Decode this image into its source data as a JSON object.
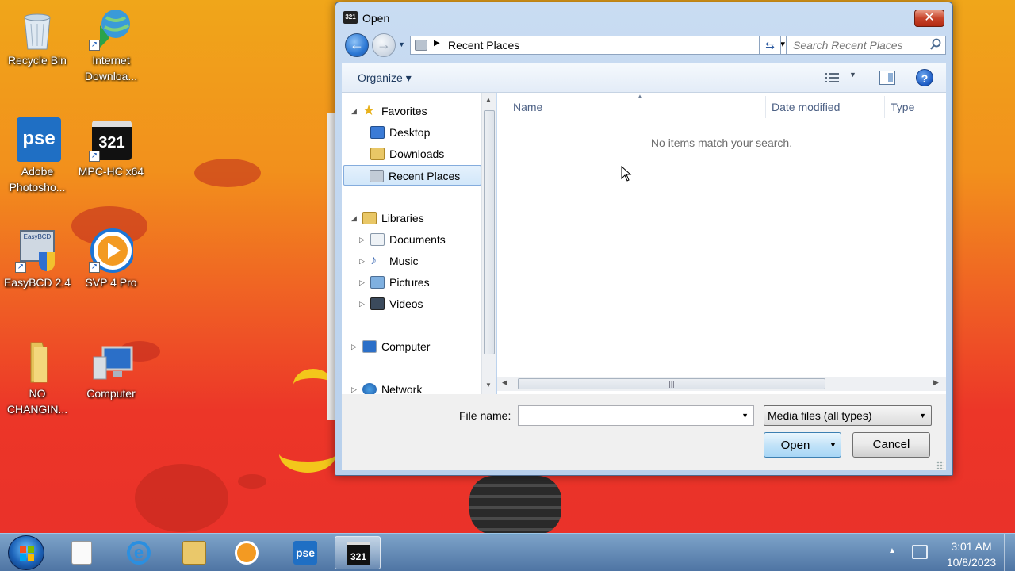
{
  "desktop": {
    "icons": [
      {
        "label": "Recycle Bin",
        "icon": "recycle-bin-icon"
      },
      {
        "label": "Internet Downloa...",
        "icon": "internet-download-manager-icon"
      },
      {
        "label": "Adobe Photosho...",
        "icon": "photoshop-elements-icon",
        "badge": "pse"
      },
      {
        "label": "MPC-HC x64",
        "icon": "mpc-hc-icon",
        "badge": "321"
      },
      {
        "label": "EasyBCD 2.4",
        "icon": "easybcd-icon",
        "badge": "EasyBCD"
      },
      {
        "label": "SVP 4 Pro",
        "icon": "svp-icon"
      },
      {
        "label": "NO CHANGIN...",
        "icon": "folder-icon"
      },
      {
        "label": "Computer",
        "icon": "computer-icon"
      }
    ]
  },
  "dialog": {
    "title": "Open",
    "title_icon_text": "321",
    "close_label": "✕",
    "address": {
      "crumb": "Recent Places"
    },
    "search": {
      "placeholder": "Search Recent Places"
    },
    "toolbar": {
      "organize": "Organize ▾"
    },
    "nav": {
      "favorites": "Favorites",
      "desktop": "Desktop",
      "downloads": "Downloads",
      "recent_places": "Recent Places",
      "libraries": "Libraries",
      "documents": "Documents",
      "music": "Music",
      "pictures": "Pictures",
      "videos": "Videos",
      "computer": "Computer",
      "network": "Network"
    },
    "columns": [
      "Name",
      "Date modified",
      "Type"
    ],
    "empty_message": "No items match your search.",
    "file_name_label": "File name:",
    "file_name_value": "",
    "file_type": "Media files (all types)",
    "open_label": "Open",
    "cancel_label": "Cancel"
  },
  "taskbar": {
    "pinned": [
      "windows-explorer-icon",
      "internet-explorer-icon",
      "folder-icon",
      "media-player-icon",
      "photoshop-elements-icon",
      "mpc-hc-icon"
    ],
    "pse_text": "pse",
    "mpc_text": "321",
    "clock_time": "3:01 AM",
    "clock_date": "10/8/2023"
  },
  "colors": {
    "accent": "#2c78d4",
    "selection": "#d2e7fa",
    "taskbar": "#4678aa"
  }
}
